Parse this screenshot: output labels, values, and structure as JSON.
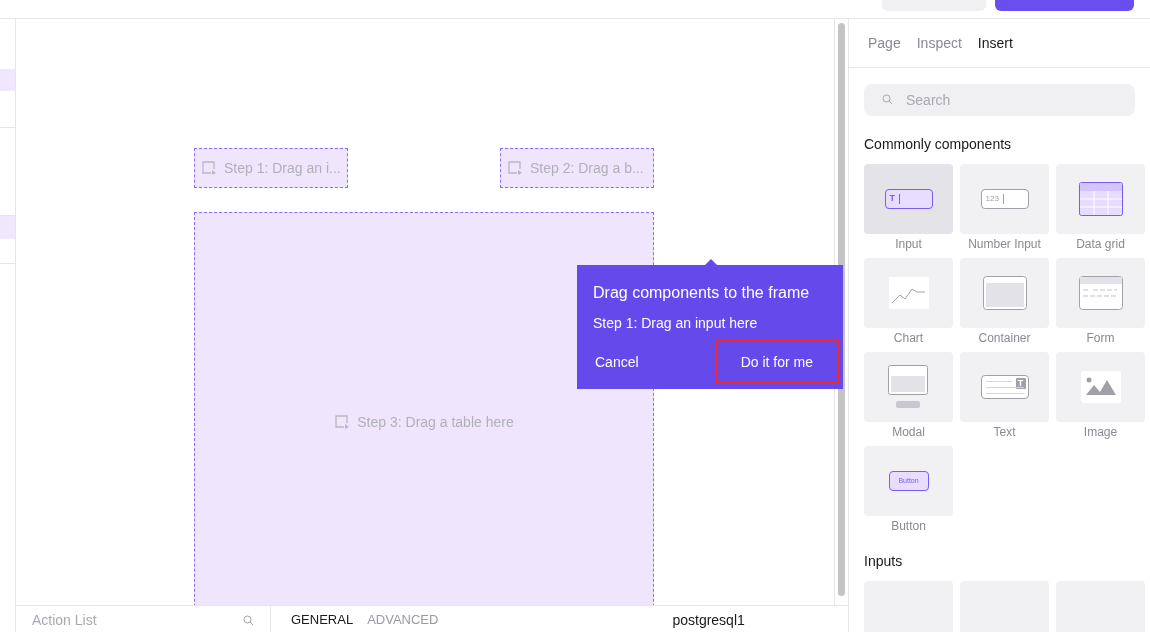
{
  "sidebar": {
    "items": [
      {
        "selected": false
      },
      {
        "selected": true
      },
      {
        "selected": false
      },
      {
        "selected": false
      },
      {
        "selected": true
      },
      {
        "selected": false
      }
    ]
  },
  "canvas": {
    "drop_zones": [
      {
        "kind": "small",
        "label": "Step 1: Drag an i..."
      },
      {
        "kind": "small",
        "label": "Step 2: Drag a b..."
      },
      {
        "kind": "large",
        "label": "Step 3: Drag a table here"
      }
    ]
  },
  "popover": {
    "title": "Drag components to the frame",
    "step": "Step 1: Drag an input here",
    "buttons": [
      {
        "label": "Cancel",
        "kind": "secondary",
        "highlighted": false
      },
      {
        "label": "Do it for me",
        "kind": "primary",
        "highlighted": true
      }
    ]
  },
  "right_panel": {
    "tabs": [
      {
        "label": "Page",
        "selected": false
      },
      {
        "label": "Inspect",
        "selected": false
      },
      {
        "label": "Insert",
        "selected": true
      }
    ],
    "search": {
      "placeholder": "Search"
    },
    "sections": [
      {
        "title": "Commonly components",
        "items": [
          {
            "kind": "input",
            "label": "Input",
            "icon_text": "T",
            "selected": true
          },
          {
            "kind": "number_input",
            "label": "Number Input",
            "icon_text": "123",
            "selected": false
          },
          {
            "kind": "data_grid",
            "label": "Data grid",
            "selected": false
          },
          {
            "kind": "chart",
            "label": "Chart",
            "selected": false
          },
          {
            "kind": "container",
            "label": "Container",
            "selected": false
          },
          {
            "kind": "form",
            "label": "Form",
            "selected": false
          },
          {
            "kind": "modal",
            "label": "Modal",
            "selected": false
          },
          {
            "kind": "text",
            "label": "Text",
            "icon_text": "T",
            "selected": false
          },
          {
            "kind": "image",
            "label": "Image",
            "selected": false
          },
          {
            "kind": "button",
            "label": "Button",
            "icon_text": "Button",
            "selected": false
          }
        ]
      },
      {
        "title": "Inputs",
        "items": [
          {
            "kind": "blank",
            "selected": false
          },
          {
            "kind": "blank",
            "selected": false
          },
          {
            "kind": "blank",
            "selected": false
          }
        ]
      }
    ]
  },
  "bottom_panel": {
    "search": {
      "placeholder": "Action List"
    },
    "tabs": [
      {
        "label": "GENERAL",
        "selected": true
      },
      {
        "label": "ADVANCED",
        "selected": false
      }
    ],
    "resource": "postgresql1"
  }
}
